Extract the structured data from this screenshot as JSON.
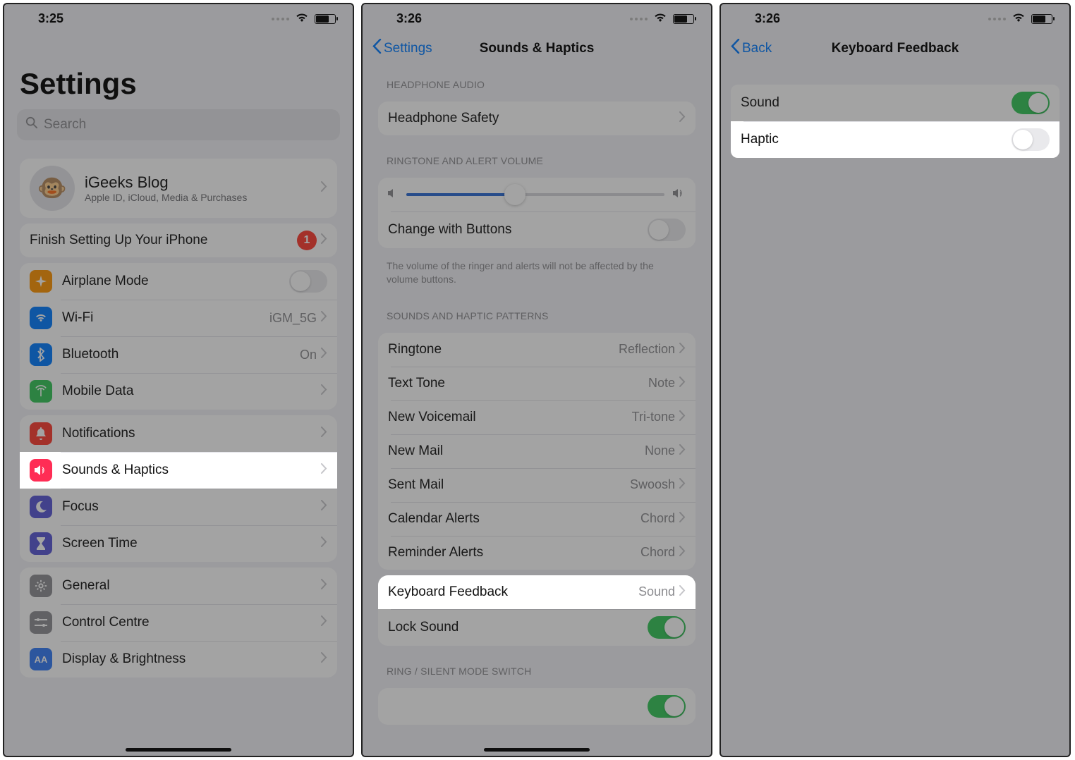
{
  "screen1": {
    "time": "3:25",
    "title": "Settings",
    "search_placeholder": "Search",
    "apple_id": {
      "name": "iGeeks Blog",
      "sub": "Apple ID, iCloud, Media & Purchases"
    },
    "setup": {
      "label": "Finish Setting Up Your iPhone",
      "badge": "1"
    },
    "rows1": {
      "airplane": "Airplane Mode",
      "wifi": "Wi-Fi",
      "wifi_value": "iGM_5G",
      "bluetooth": "Bluetooth",
      "bluetooth_value": "On",
      "mobile": "Mobile Data"
    },
    "rows2": {
      "notifications": "Notifications",
      "sounds": "Sounds & Haptics",
      "focus": "Focus",
      "screentime": "Screen Time"
    },
    "rows3": {
      "general": "General",
      "control": "Control Centre",
      "display": "Display & Brightness"
    }
  },
  "screen2": {
    "time": "3:26",
    "back": "Settings",
    "title": "Sounds & Haptics",
    "sect1": "HEADPHONE AUDIO",
    "headphone_safety": "Headphone Safety",
    "sect2": "RINGTONE AND ALERT VOLUME",
    "change_buttons": "Change with Buttons",
    "change_footer": "The volume of the ringer and alerts will not be affected by the volume buttons.",
    "sect3": "SOUNDS AND HAPTIC PATTERNS",
    "rows": {
      "ringtone": "Ringtone",
      "ringtone_v": "Reflection",
      "texttone": "Text Tone",
      "texttone_v": "Note",
      "voicemail": "New Voicemail",
      "voicemail_v": "Tri-tone",
      "newmail": "New Mail",
      "newmail_v": "None",
      "sentmail": "Sent Mail",
      "sentmail_v": "Swoosh",
      "calendar": "Calendar Alerts",
      "calendar_v": "Chord",
      "reminder": "Reminder Alerts",
      "reminder_v": "Chord"
    },
    "keyboard": "Keyboard Feedback",
    "keyboard_v": "Sound",
    "lock": "Lock Sound",
    "sect4": "RING / SILENT MODE SWITCH"
  },
  "screen3": {
    "time": "3:26",
    "back": "Back",
    "title": "Keyboard Feedback",
    "sound": "Sound",
    "haptic": "Haptic"
  }
}
